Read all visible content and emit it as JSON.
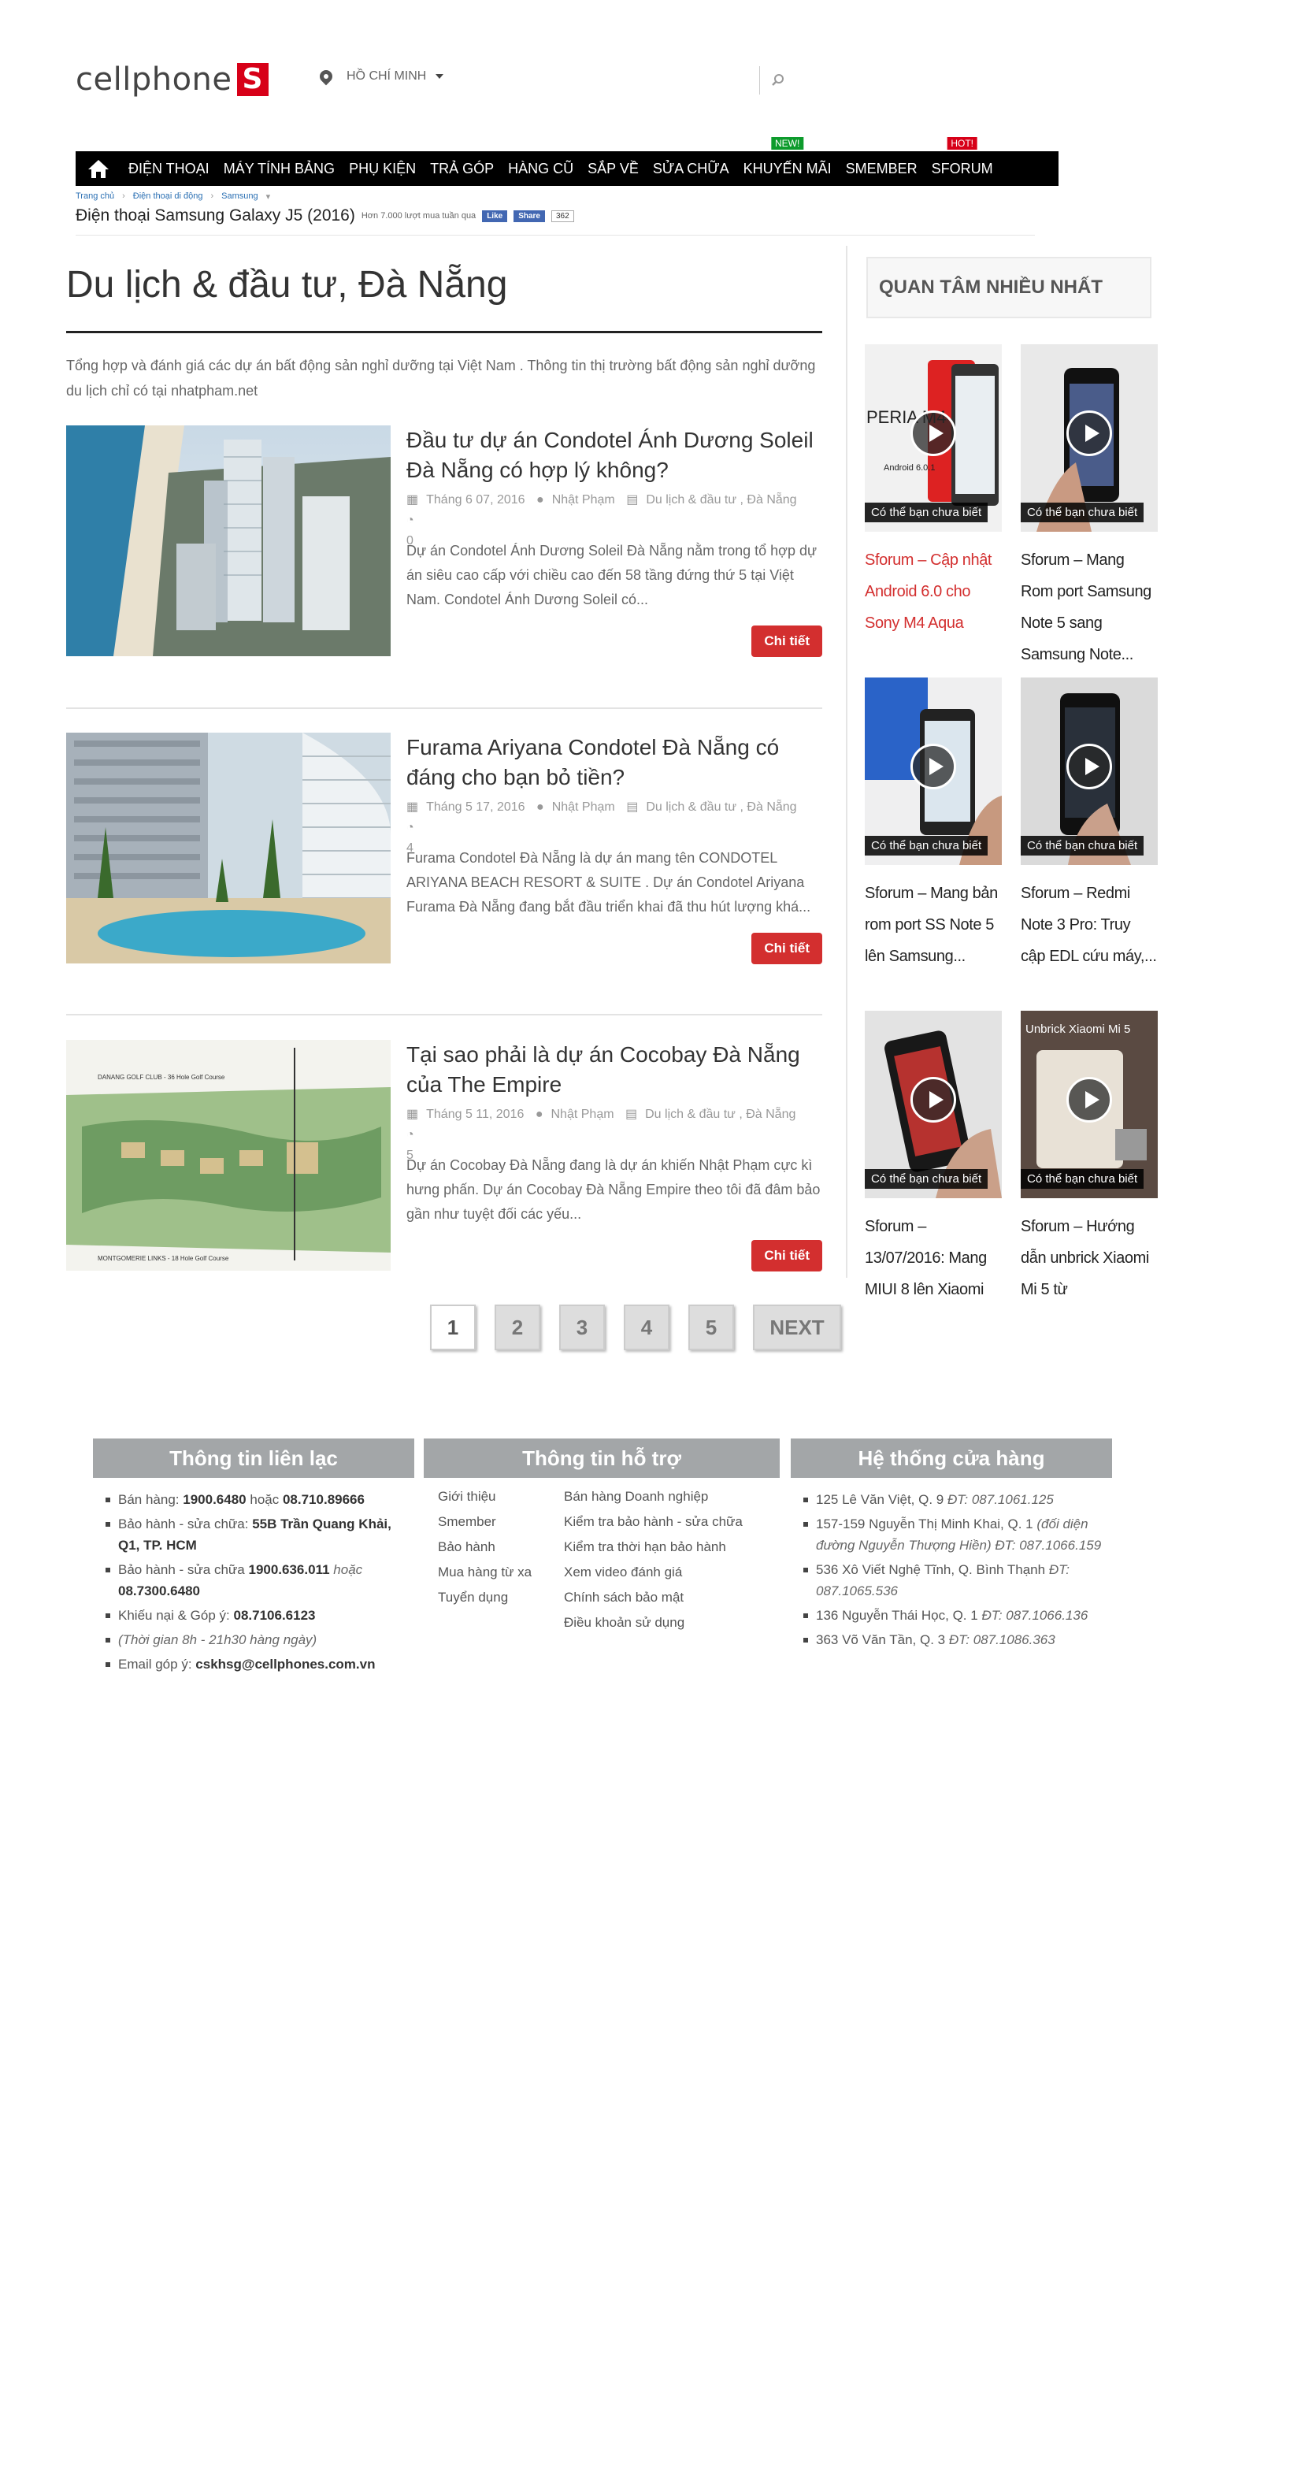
{
  "header": {
    "logo_text": "cellphone",
    "location": "HỒ CHÍ MINH",
    "search_placeholder": ""
  },
  "nav": {
    "items": [
      {
        "label": "ĐIỆN THOẠI"
      },
      {
        "label": "MÁY TÍNH BẢNG"
      },
      {
        "label": "PHỤ KIỆN"
      },
      {
        "label": "TRẢ GÓP"
      },
      {
        "label": "HÀNG CŨ"
      },
      {
        "label": "SẮP VỀ"
      },
      {
        "label": "SỬA CHỮA"
      },
      {
        "label": "KHUYẾN MÃI",
        "badge": "NEW!"
      },
      {
        "label": "SMEMBER"
      },
      {
        "label": "SFORUM",
        "badge": "HOT!"
      }
    ]
  },
  "breadcrumb": [
    "Trang chủ",
    "Điện thoại di động",
    "Samsung"
  ],
  "product_line": {
    "name": "Điện thoại Samsung Galaxy J5 (2016)",
    "sub": "Hơn 7.000 lượt mua tuần qua",
    "like": "Like",
    "share": "Share",
    "count": "362"
  },
  "main": {
    "title": "Du lịch & đầu tư, Đà Nẵng",
    "intro": "Tổng hợp và đánh giá các dự án bất động sản nghỉ dưỡng tại Việt Nam . Thông tin thị trường bất động sản nghỉ dưỡng du lịch chỉ có tại nhatpham.net",
    "posts": [
      {
        "title": "Đầu tư dự án Condotel Ánh Dương Soleil Đà Nẵng có hợp lý không?",
        "date": "Tháng 6 07, 2016",
        "author": "Nhật Phạm",
        "category": "Du lịch & đầu tư , Đà Nẵng",
        "comments": "0",
        "excerpt": "Dự án Condotel Ánh Dương Soleil Đà Nẵng nằm trong tổ hợp dự án siêu cao cấp với chiều cao đến 58 tầng đứng thứ 5 tại Việt Nam. Condotel Ánh Dương Soleil có...",
        "more": "Chi tiết"
      },
      {
        "title": "Furama Ariyana Condotel Đà Nẵng có đáng cho bạn bỏ tiền?",
        "date": "Tháng 5 17, 2016",
        "author": "Nhật Phạm",
        "category": "Du lịch & đầu tư , Đà Nẵng",
        "comments": "4",
        "excerpt": "Furama Condotel Đà Nẵng là dự án mang tên CONDOTEL ARIYANA BEACH RESORT & SUITE . Dự án Condotel Ariyana Furama Đà Nẵng đang bắt đầu triển khai đã thu hút lượng khá...",
        "more": "Chi tiết"
      },
      {
        "title": "Tại sao phải là dự án Cocobay Đà Nẵng của The Empire",
        "date": "Tháng 5 11, 2016",
        "author": "Nhật Phạm",
        "category": "Du lịch & đầu tư , Đà Nẵng",
        "comments": "5",
        "excerpt": "Dự án Cocobay Đà Nẵng đang là dự án khiến Nhật Phạm cực kì hưng phấn. Dự án Cocobay Đà Nẵng Empire theo tôi đã đâm bảo gần như tuyệt đối các yếu...",
        "more": "Chi tiết",
        "map_top": "DANANG GOLF CLUB - 36 Hole Golf Course",
        "map_bottom": "MONTGOMERIE LINKS - 18 Hole Golf Course"
      }
    ]
  },
  "pagination": [
    "1",
    "2",
    "3",
    "4",
    "5",
    "NEXT"
  ],
  "sidebar": {
    "title": "QUAN TÂM NHIỀU NHẤT",
    "tag": "Có thể bạn chưa biết",
    "cards": [
      {
        "title": "Sforum – Cập nhật Android 6.0 cho Sony M4 Aqua",
        "img_text": "PERIA M4",
        "img_sub": "Android 6.0.1"
      },
      {
        "title": "Sforum – Mang Rom port Samsung Note 5 sang Samsung Note..."
      },
      {
        "title": "Sforum – Mang bản rom port SS Note 5 lên Samsung..."
      },
      {
        "title": "Sforum – Redmi Note 3 Pro: Truy cập EDL cứu máy,..."
      },
      {
        "title": "Sforum – 13/07/2016: Mang MIUI 8 lên Xiaomi"
      },
      {
        "title": "Sforum – Hướng dẫn unbrick Xiaomi Mi 5 từ",
        "img_text": "Unbrick Xiaomi Mi 5"
      }
    ]
  },
  "footer": {
    "contact": {
      "title": "Thông tin liên lạc",
      "sales_label": "Bán hàng:",
      "sales_1": "1900.6480",
      "sales_or": "hoặc",
      "sales_2": "08.710.89666",
      "warranty1_label": "Bảo hành - sửa chữa:",
      "warranty1_addr": "55B Trần Quang Khải, Q1, TP. HCM",
      "warranty2_label": "Bảo hành - sửa chữa",
      "warranty2_1": "1900.636.011",
      "warranty2_or": "hoặc",
      "warranty2_2": "08.7300.6480",
      "complaint_label": "Khiếu nại & Góp ý:",
      "complaint_phone": "08.7106.6123",
      "hours": "(Thời gian 8h - 21h30 hàng ngày)",
      "email_label": "Email góp ý:",
      "email": "cskhsg@cellphones.com.vn"
    },
    "support": {
      "title": "Thông tin hỗ trợ",
      "left": [
        "Giới thiệu",
        "Smember",
        "Bảo hành",
        "Mua hàng từ xa",
        "Tuyển dụng"
      ],
      "right": [
        "Bán hàng Doanh nghiệp",
        "Kiểm tra bảo hành - sửa chữa",
        "Kiểm tra thời hạn bảo hành",
        "Xem video đánh giá",
        "Chính sách bảo mật",
        "Điều khoản sử dụng"
      ]
    },
    "stores": {
      "title": "Hệ thống cửa hàng",
      "items": [
        {
          "addr": "125 Lê Văn Việt, Q. 9",
          "phone": "ĐT: 087.1061.125"
        },
        {
          "addr": "157-159 Nguyễn Thị Minh Khai, Q. 1",
          "note": "(đối diện đường Nguyễn Thượng Hiền)",
          "phone": "ĐT: 087.1066.159"
        },
        {
          "addr": "536 Xô Viết Nghệ Tĩnh, Q. Bình Thạnh",
          "phone": "ĐT: 087.1065.536"
        },
        {
          "addr": "136 Nguyễn Thái Học, Q. 1",
          "phone": "ĐT: 087.1066.136"
        },
        {
          "addr": "363 Võ Văn Tần, Q. 3",
          "phone": "ĐT: 087.1086.363"
        }
      ]
    }
  }
}
